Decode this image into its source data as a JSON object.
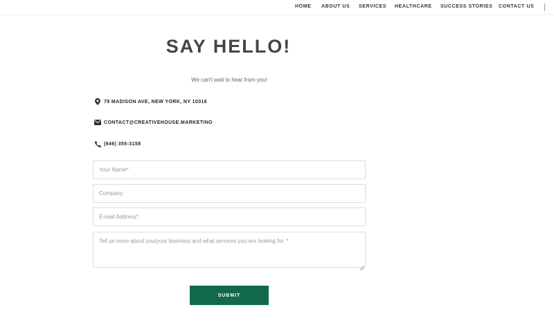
{
  "nav": {
    "items": [
      {
        "label": "HOME"
      },
      {
        "label": "ABOUT US"
      },
      {
        "label": "SERVICES"
      },
      {
        "label": "HEALTHCARE"
      },
      {
        "label": "SUCCESS STORIES"
      },
      {
        "label": "CONTACT US"
      }
    ]
  },
  "header": {
    "title": "SAY HELLO!",
    "subtitle": "We can't wait to hear from you!"
  },
  "contact": {
    "address": {
      "icon": "map-pin-icon",
      "text": "79 MADISON AVE, NEW YORK, NY 10016"
    },
    "email": {
      "icon": "envelope-icon",
      "text": "CONTACT@CREATIVEHOUSE.MARKETING"
    },
    "phone": {
      "icon": "phone-icon",
      "text": "(646) 355-3158"
    }
  },
  "form": {
    "name_placeholder": "Your Name*",
    "company_placeholder": "Company",
    "email_placeholder": "E-mail Address*",
    "message_placeholder": "Tell us more about you/your business and what services you are looking for. *",
    "submit_label": "SUBMIT"
  },
  "colors": {
    "submit_background": "#11694a",
    "headline": "#444444"
  }
}
